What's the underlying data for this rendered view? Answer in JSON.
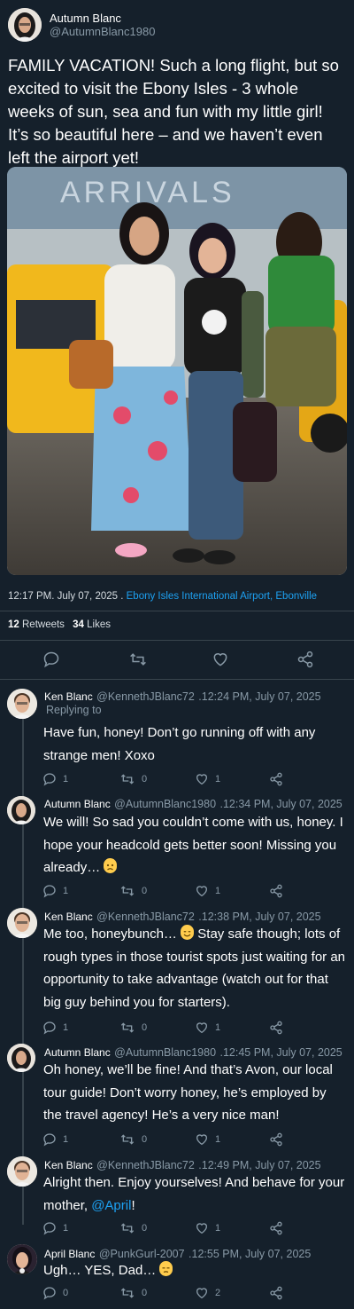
{
  "tweet": {
    "author_name": "Autumn Blanc",
    "author_handle": "@AutumnBlanc1980",
    "text": "FAMILY VACATION! Such a long flight, but so excited to visit the Ebony Isles - 3 whole weeks of sun, sea and fun with my little girl! It’s so beautiful here – and we haven’t even left the airport yet!",
    "photo_sign": "ARRIVALS",
    "timestamp": "12:17 PM. July 07, 2025 .",
    "location": "Ebony Isles International Airport, Ebonville",
    "retweets_count": "12",
    "retweets_label": "Retweets",
    "likes_count": "34",
    "likes_label": "Likes"
  },
  "replies": [
    {
      "name": "Ken Blanc",
      "handle": "@KennethJBlanc72",
      "time": ".12:24 PM, July 07, 2025",
      "replying_to": "Replying to",
      "line1": "Have fun, honey! Don’t go running off with any",
      "line2": "strange men! Xoxo",
      "reply_count": "1",
      "retweet_count": "0",
      "like_count": "1"
    },
    {
      "name": "Autumn Blanc",
      "handle": "@AutumnBlanc1980",
      "time": ".12:34 PM, July 07, 2025",
      "line1": "We will! So sad you couldn’t come with us, honey. I",
      "line2": "hope your headcold gets better soon! Missing you",
      "line3": "already…",
      "reply_count": "1",
      "retweet_count": "0",
      "like_count": "1"
    },
    {
      "name": "Ken Blanc",
      "handle": "@KennethJBlanc72",
      "time": ".12:38 PM, July 07, 2025",
      "line1": "Me too, honeybunch…",
      "line1b": "Stay safe though; lots of",
      "line2": "rough types in those tourist spots just waiting for an",
      "line3": "opportunity to take advantage (watch out for that",
      "line4": "big guy behind you for starters).",
      "reply_count": "1",
      "retweet_count": "0",
      "like_count": "1"
    },
    {
      "name": "Autumn Blanc",
      "handle": "@AutumnBlanc1980",
      "time": ".12:45 PM, July 07, 2025",
      "line1": "Oh honey, we’ll be fine! And that’s Avon, our local",
      "line2": "tour guide! Don’t worry honey, he’s employed by",
      "line3": "the travel agency! He’s a very nice man!",
      "reply_count": "1",
      "retweet_count": "0",
      "like_count": "1"
    },
    {
      "name": "Ken Blanc",
      "handle": "@KennethJBlanc72",
      "time": ".12:49 PM, July 07, 2025",
      "line1": "Alright then. Enjoy yourselves! And behave for your",
      "line2": "mother,",
      "mention": "@April",
      "line2_end": "!",
      "reply_count": "1",
      "retweet_count": "0",
      "like_count": "1"
    },
    {
      "name": "April Blanc",
      "handle": "@PunkGurl-2007",
      "time": ".12:55 PM, July 07, 2025",
      "line1": "Ugh… YES, Dad…",
      "reply_count": "0",
      "retweet_count": "0",
      "like_count": "2"
    }
  ],
  "icons": [
    "reply-icon",
    "retweet-icon",
    "like-icon",
    "share-icon"
  ],
  "colors": {
    "background": "#15202b",
    "divider": "#38444d",
    "muted": "#8899a6",
    "link": "#1da1f2"
  }
}
